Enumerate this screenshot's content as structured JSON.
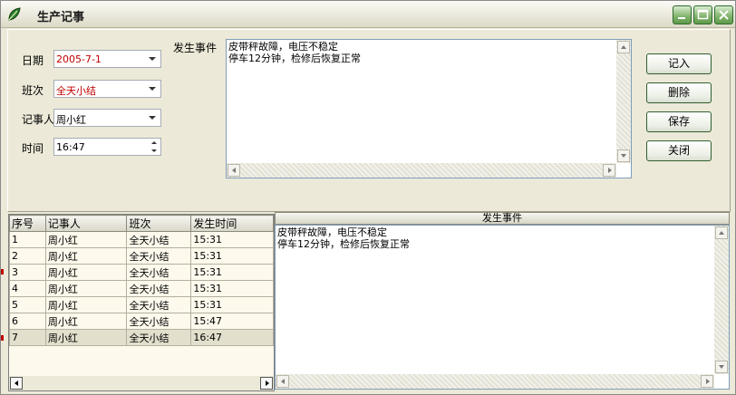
{
  "window": {
    "title": "生产记事"
  },
  "form": {
    "date_label": "日期",
    "date_value": "2005-7-1",
    "shift_label": "班次",
    "shift_value": "全天小结",
    "recorder_label": "记事人",
    "recorder_value": "周小红",
    "time_label": "时间",
    "time_value": "16:47",
    "event_label": "发生事件",
    "event_text": "皮带秤故障，电压不稳定\n停车12分钟，检修后恢复正常"
  },
  "buttons": {
    "record": "记入",
    "delete": "删除",
    "save": "保存",
    "close": "关闭"
  },
  "grid": {
    "columns": [
      "序号",
      "记事人",
      "班次",
      "发生时间"
    ],
    "rows": [
      [
        "1",
        "周小红",
        "全天小结",
        "15:31"
      ],
      [
        "2",
        "周小红",
        "全天小结",
        "15:31"
      ],
      [
        "3",
        "周小红",
        "全天小结",
        "15:31"
      ],
      [
        "4",
        "周小红",
        "全天小结",
        "15:31"
      ],
      [
        "5",
        "周小红",
        "全天小结",
        "15:31"
      ],
      [
        "6",
        "周小红",
        "全天小结",
        "15:47"
      ],
      [
        "7",
        "周小红",
        "全天小结",
        "16:47"
      ]
    ],
    "selected_index": 6
  },
  "detail": {
    "header": "发生事件",
    "text": "皮带秤故障，电压不稳定\n停车12分钟，检修后恢复正常"
  },
  "colors": {
    "accent": "#c00000",
    "button_border": "#2f5f2f",
    "titlebar_button": "#7fb36a"
  }
}
